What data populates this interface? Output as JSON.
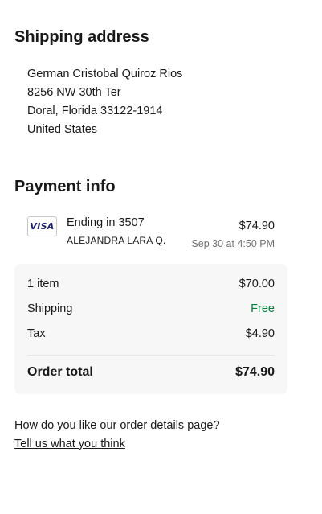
{
  "shipping": {
    "title": "Shipping address",
    "name": "German Cristobal Quiroz Rios",
    "street": "8256 NW 30th Ter",
    "city_line": "Doral, Florida 33122-1914",
    "country": "United States"
  },
  "payment": {
    "title": "Payment info",
    "card_brand": "VISA",
    "card_icon": "visa-card-icon",
    "ending": "Ending in 3507",
    "holder": "ALEJANDRA LARA Q.",
    "amount": "$74.90",
    "date": "Sep 30 at 4:50 PM"
  },
  "summary": {
    "items_label": "1 item",
    "items_value": "$70.00",
    "shipping_label": "Shipping",
    "shipping_value": "Free",
    "tax_label": "Tax",
    "tax_value": "$4.90",
    "total_label": "Order total",
    "total_value": "$74.90"
  },
  "feedback": {
    "question": "How do you like our order details page?",
    "link": "Tell us what you think"
  },
  "colors": {
    "text": "#191919",
    "muted": "#707070",
    "free": "#05823f",
    "panel": "#f7f7f7",
    "visa": "#1a1f71"
  }
}
